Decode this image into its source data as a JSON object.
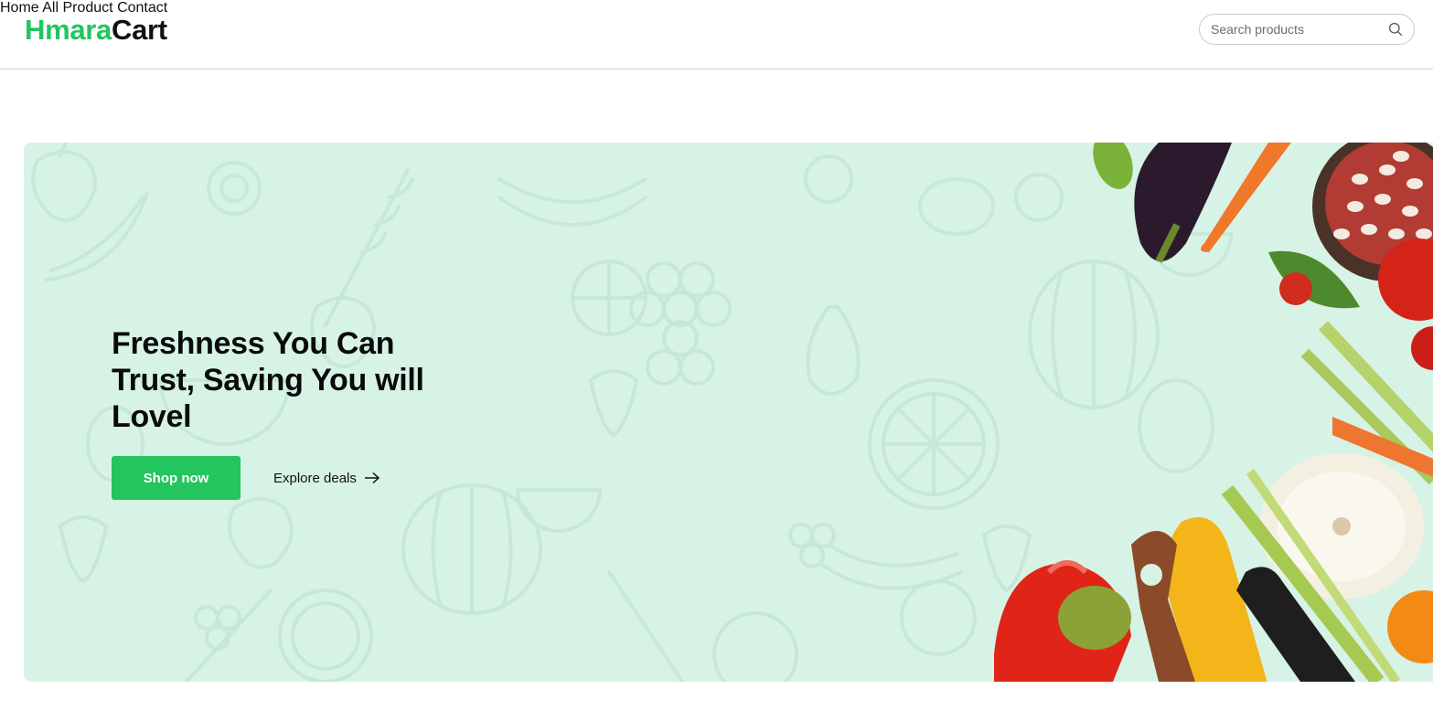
{
  "brand": {
    "name_part1": "Hmara",
    "name_part2": "Cart",
    "accent_color": "#22c55e"
  },
  "nav": {
    "items": [
      "Home",
      "All Product",
      "Contact"
    ]
  },
  "search": {
    "placeholder": "Search products",
    "icon": "search-icon"
  },
  "hero": {
    "headline": "Freshness You Can Trust, Saving You will Lovel",
    "primary_button": "Shop now",
    "secondary_link": "Explore deals",
    "secondary_icon": "arrow-right-icon",
    "background_color": "#d7f3e5"
  }
}
